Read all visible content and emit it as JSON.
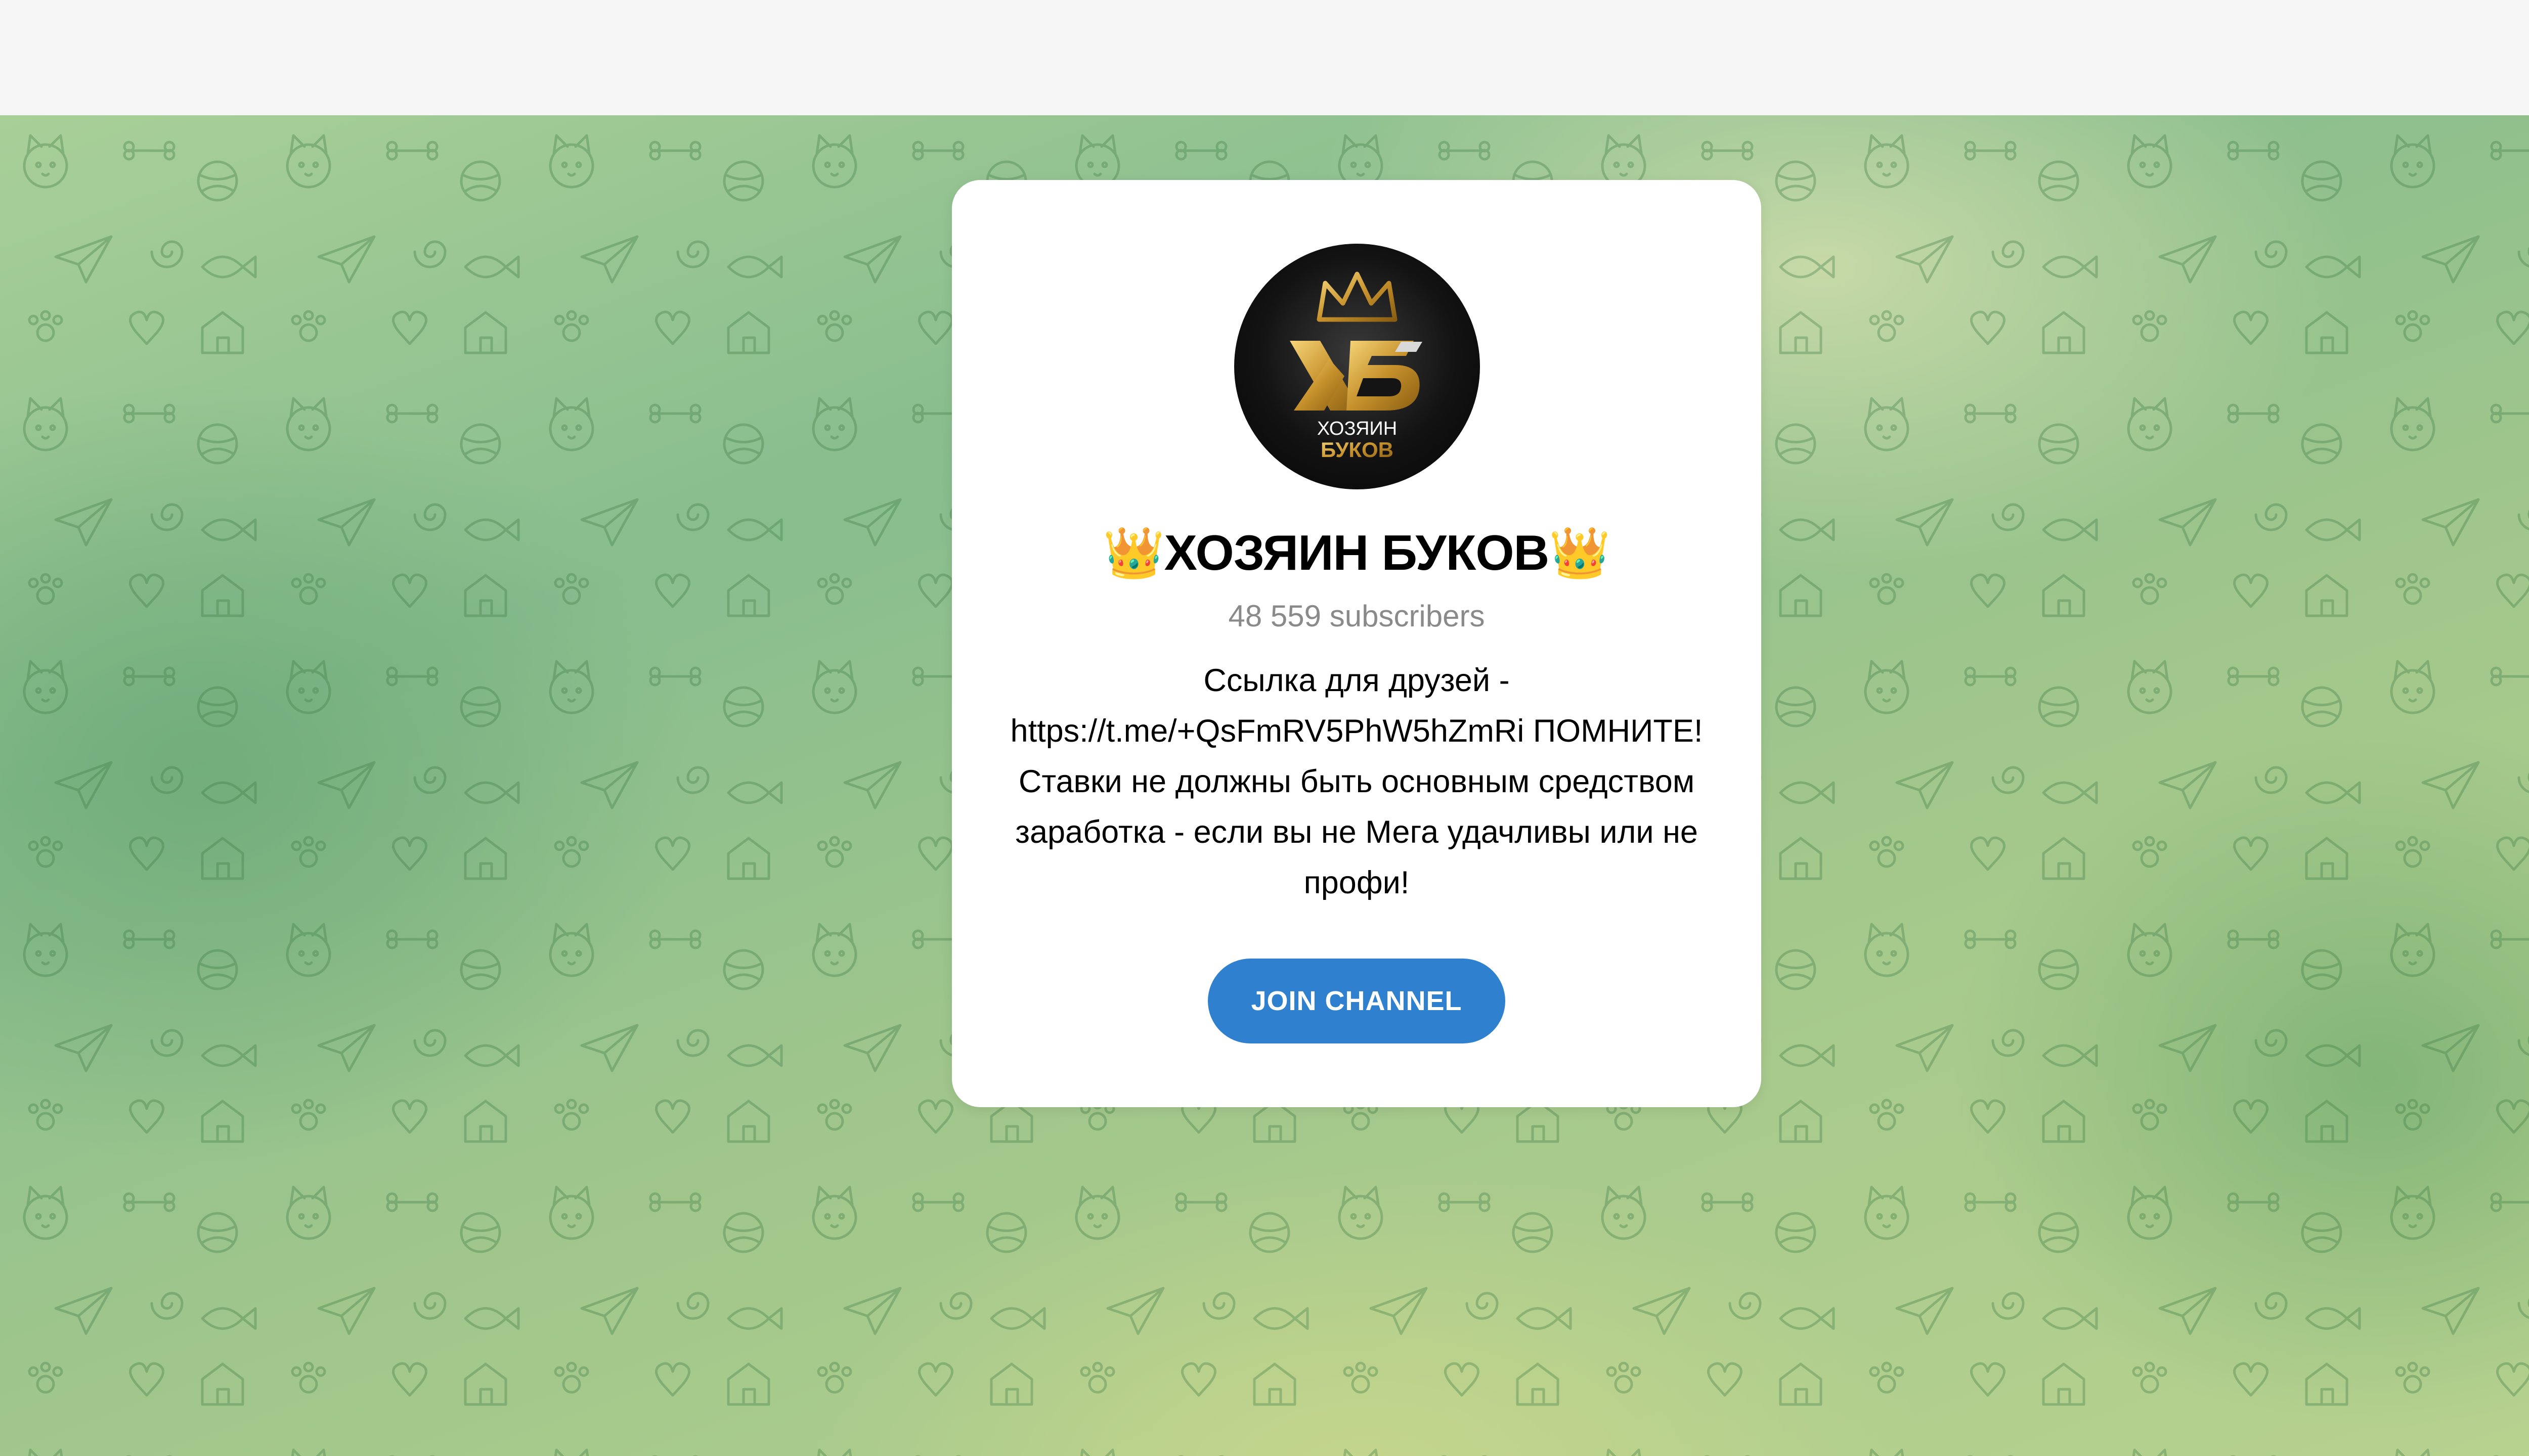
{
  "channel": {
    "title": "👑ХОЗЯИН БУКОВ👑",
    "subscribers": "48 559 subscribers",
    "description": "Ссылка для друзей - https://t.me/+QsFmRV5PhW5hZmRi ПОМНИТЕ! Ставки не должны быть основным средством заработка - если вы не Мега удачливы или не профи!",
    "avatar_logo_text_line1": "ХОЗЯИН",
    "avatar_logo_text_line2": "БУКОВ"
  },
  "actions": {
    "join_label": "JOIN CHANNEL"
  },
  "colors": {
    "accent": "#2f80cf",
    "card_background": "#ffffff",
    "wallpaper_green": "#88bd8e",
    "logo_gold": "#d4a437"
  },
  "icons": {
    "avatar": "channel-logo-crown-kb",
    "wallpaper": "doodle-pattern"
  }
}
